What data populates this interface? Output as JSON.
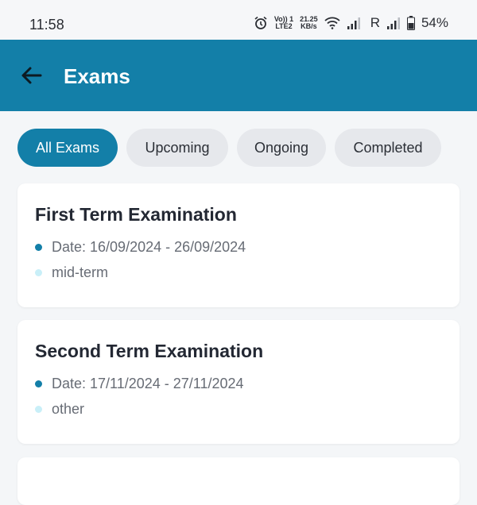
{
  "status_bar": {
    "time": "11:58",
    "network_line1": "Vo)) 1",
    "network_line2": "LTE2",
    "speed_line1": "21.25",
    "speed_line2": "KB/s",
    "roaming": "R",
    "battery": "54%",
    "icons": [
      "alarm-icon",
      "wifi-icon",
      "signal-icon",
      "signal-icon",
      "battery-icon"
    ]
  },
  "app_bar": {
    "title": "Exams",
    "back_icon": "arrow-left-icon",
    "color": "#137fa8"
  },
  "filters": {
    "chips": [
      {
        "label": "All Exams",
        "active": true
      },
      {
        "label": "Upcoming",
        "active": false
      },
      {
        "label": "Ongoing",
        "active": false
      },
      {
        "label": "Completed",
        "active": false
      }
    ]
  },
  "exams": [
    {
      "title": "First Term Examination",
      "date": "Date: 16/09/2024 - 26/09/2024",
      "type": "mid-term"
    },
    {
      "title": "Second Term Examination",
      "date": "Date: 17/11/2024 - 27/11/2024",
      "type": "other"
    }
  ]
}
